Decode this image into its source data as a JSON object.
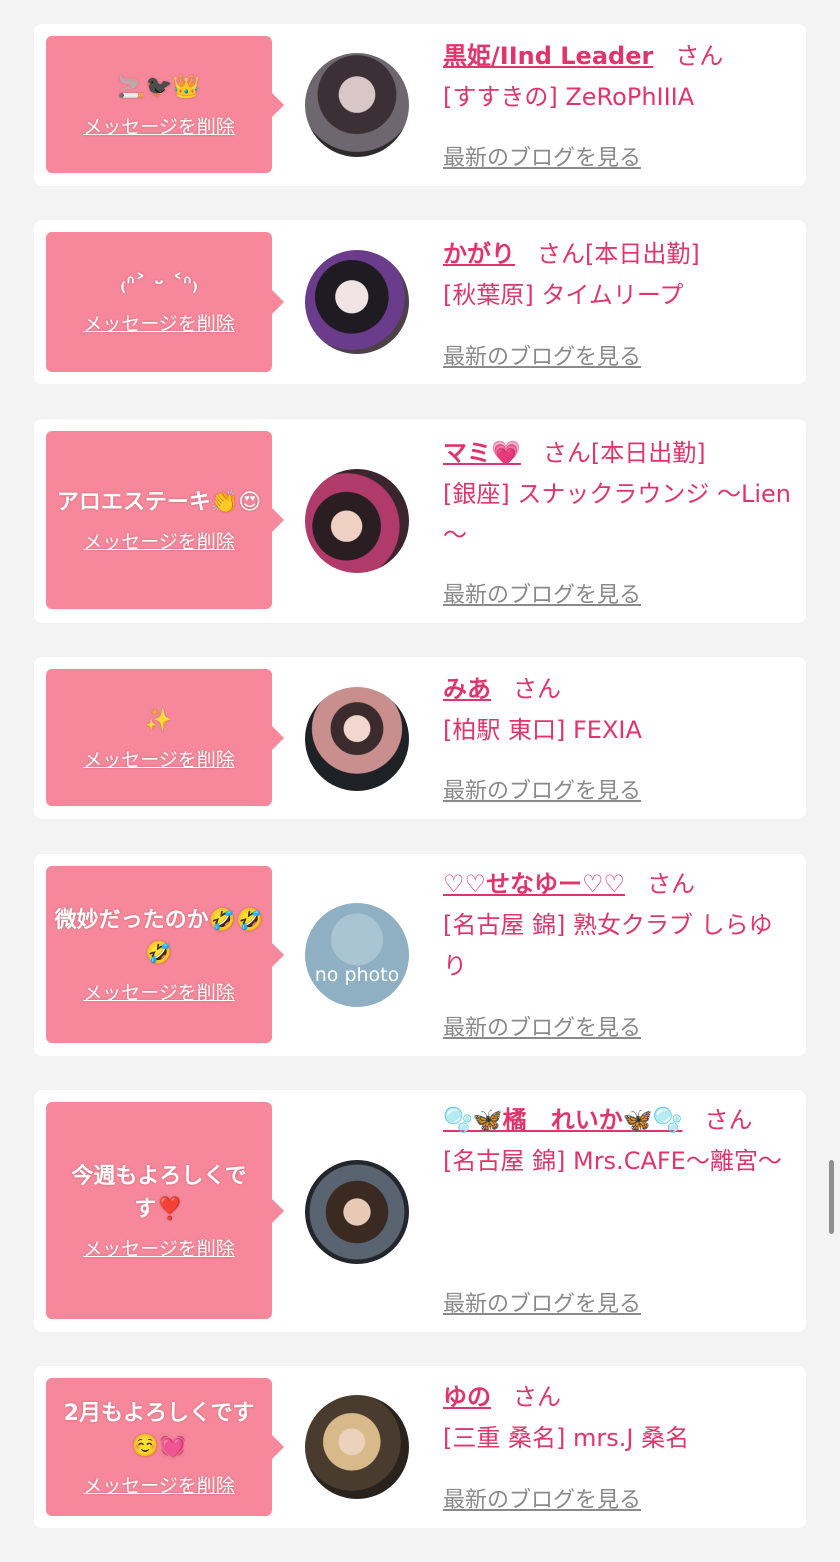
{
  "delete_label": "メッセージを削除",
  "blog_label": "最新のブログを見る",
  "san_label": "さん",
  "colors": {
    "accent": "#e0356a",
    "bubble": "#f7879a",
    "background": "#f3f3f3"
  },
  "entries": [
    {
      "message": "🚬🐦‍⬛👑",
      "name": "黒姫/IInd Leader",
      "badge": "",
      "shop": "[すすきの] ZeRoPhIIIA"
    },
    {
      "message": "₍ᐢ˃ ᵕ ˂ᐢ₎",
      "name": "かがり",
      "badge": "[本日出勤]",
      "shop": "[秋葉原] タイムリープ"
    },
    {
      "message": "アロエステーキ👏😍",
      "name": "マミ💗",
      "badge": "[本日出勤]",
      "shop": "[銀座] スナックラウンジ ～Lien～"
    },
    {
      "message": "✨",
      "name": "みあ",
      "badge": "",
      "shop": "[柏駅 東口] FEXIA"
    },
    {
      "message": "微妙だったのか🤣🤣🤣",
      "name": "♡♡せなゆー♡♡",
      "badge": "",
      "shop": "[名古屋 錦] 熟女クラブ しらゆり",
      "avatar_text": "no photo"
    },
    {
      "message": "今週もよろしくです❣️",
      "name": "🫧🦋橘　れいか🦋🫧",
      "badge": "",
      "shop": "[名古屋 錦] Mrs.CAFE～離宮～"
    },
    {
      "message": "2月もよろしくです☺️💓",
      "name": "ゆの",
      "badge": "",
      "shop": "[三重 桑名] mrs.J 桑名"
    }
  ]
}
